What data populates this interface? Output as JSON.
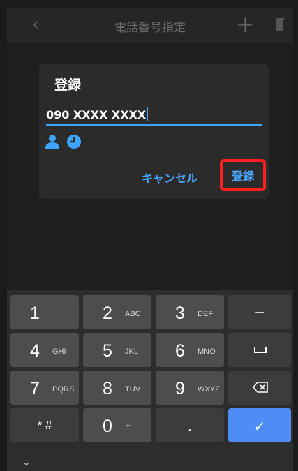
{
  "top_bar": {
    "back_icon": "chevron-left-icon",
    "title": "電話番号指定",
    "add_icon": "plus-icon",
    "delete_icon": "trash-icon"
  },
  "dialog": {
    "title": "登録",
    "input_value": "090 XXXX XXXX",
    "contact_icon": "contact-person-icon",
    "history_icon": "clock-history-icon",
    "cancel_label": "キャンセル",
    "register_label": "登録",
    "highlight_color": "#ff1f1f",
    "accent_color": "#4ba8ff"
  },
  "keyboard": {
    "rows": [
      [
        {
          "main": "1",
          "sub": ""
        },
        {
          "main": "2",
          "sub": "ABC"
        },
        {
          "main": "3",
          "sub": "DEF"
        },
        {
          "main": "−",
          "sub": ""
        }
      ],
      [
        {
          "main": "4",
          "sub": "GHI"
        },
        {
          "main": "5",
          "sub": "JKL"
        },
        {
          "main": "6",
          "sub": "MNO"
        },
        {
          "main": "␣",
          "sub": ""
        }
      ],
      [
        {
          "main": "7",
          "sub": "PQRS"
        },
        {
          "main": "8",
          "sub": "TUV"
        },
        {
          "main": "9",
          "sub": "WXYZ"
        },
        {
          "main": "⌫",
          "sub": ""
        }
      ],
      [
        {
          "main": "* #",
          "sub": ""
        },
        {
          "main": "0",
          "sub": "+"
        },
        {
          "main": ".",
          "sub": ""
        },
        {
          "main": "✓",
          "sub": ""
        }
      ]
    ],
    "hide_icon": "chevron-down-icon",
    "hide_symbol": "⌄"
  }
}
